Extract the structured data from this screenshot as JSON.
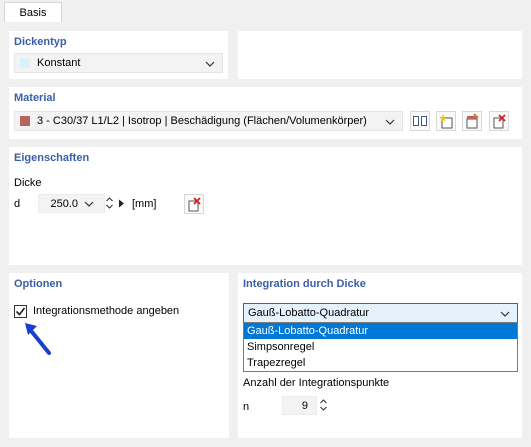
{
  "tabs": [
    {
      "label": "Basis"
    }
  ],
  "dickentyp": {
    "title": "Dickentyp",
    "value": "Konstant",
    "swatch_color": "#d9f2fa"
  },
  "material": {
    "title": "Material",
    "value": "3 - C30/37 L1/L2 | Isotrop | Beschädigung (Flächen/Volumenkörper)",
    "swatch_color": "#b5655c",
    "tool_icons": [
      "library-icon",
      "new-material-icon",
      "edit-material-icon",
      "delete-material-icon"
    ]
  },
  "eigenschaften": {
    "title": "Eigenschaften",
    "dicke_label": "Dicke",
    "symbol": "d",
    "value": "250.0",
    "unit": "[mm]"
  },
  "optionen": {
    "title": "Optionen",
    "checkbox_label": "Integrationsmethode angeben",
    "checked": true,
    "arrow_color": "#1a3fd0"
  },
  "integration": {
    "title": "Integration durch Dicke",
    "selected": "Gauß-Lobatto-Quadratur",
    "options": [
      "Gauß-Lobatto-Quadratur",
      "Simpsonregel",
      "Trapezregel"
    ],
    "points_label": "Anzahl der Integrationspunkte",
    "points_symbol": "n",
    "points_value": "9",
    "highlight_color": "#0078d7"
  }
}
